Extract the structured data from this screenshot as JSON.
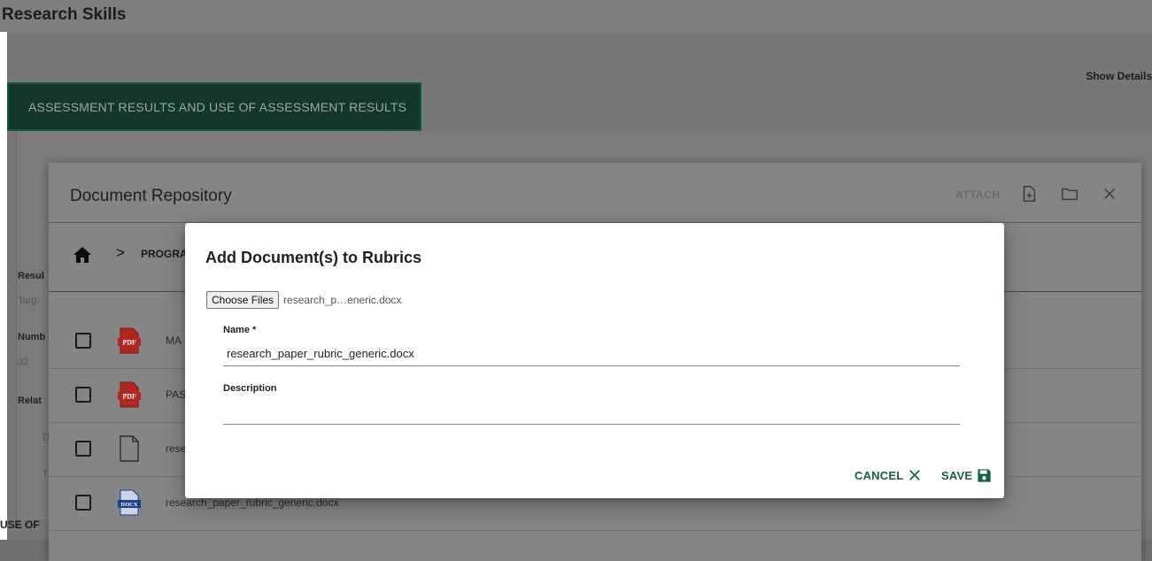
{
  "page": {
    "title": "Research Skills",
    "show_details": "Show Details",
    "tab_label": "ASSESSMENT RESULTS AND USE OF ASSESSMENT RESULTS",
    "use_of_label": "USE OF",
    "side_labels": [
      "Resul",
      "Targ",
      "Numb",
      "32",
      "Relat",
      "D",
      "T"
    ]
  },
  "repository": {
    "title": "Document Repository",
    "attach_label": "ATTACH",
    "breadcrumb": "PROGRA",
    "files": [
      {
        "icon": "pdf-icon",
        "name": "MA"
      },
      {
        "icon": "pdf-icon",
        "name": "PAS"
      },
      {
        "icon": "file-icon",
        "name": "rese"
      },
      {
        "icon": "docx-icon",
        "name": "research_paper_rubric_generic.docx"
      }
    ]
  },
  "modal": {
    "title": "Add Document(s) to Rubrics",
    "choose_files_label": "Choose Files",
    "chosen_file": "research_p…eneric.docx",
    "name_label": "Name *",
    "name_value": "research_paper_rubric_generic.docx",
    "description_label": "Description",
    "description_value": "",
    "cancel_label": "CANCEL",
    "save_label": "SAVE"
  },
  "colors": {
    "accent": "#17604a",
    "pdf_red": "#b3261e",
    "docx_blue": "#1d3f8f"
  }
}
